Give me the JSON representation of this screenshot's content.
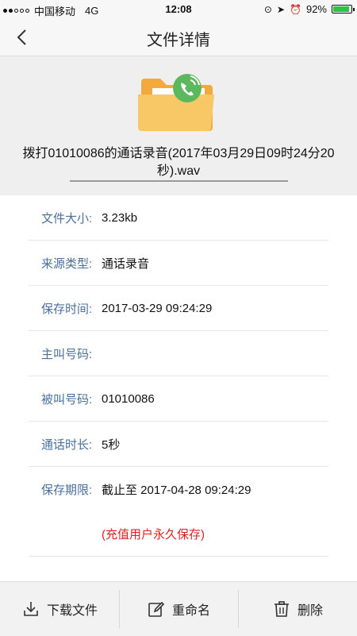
{
  "status_bar": {
    "carrier": "中国移动",
    "network": "4G",
    "time": "12:08",
    "battery_percent": "92%",
    "battery_level": 0.92,
    "icons": [
      "rotation-lock-icon",
      "location-icon",
      "alarm-icon",
      "battery-icon"
    ]
  },
  "nav": {
    "title": "文件详情",
    "back_icon": "chevron-left-icon"
  },
  "file": {
    "icon": "folder-phone-icon",
    "name": "拨打01010086的通话录音(2017年03月29日09时24分20秒).wav"
  },
  "details": [
    {
      "label": "文件大小:",
      "value": "3.23kb"
    },
    {
      "label": "来源类型:",
      "value": "通话录音"
    },
    {
      "label": "保存时间:",
      "value": "2017-03-29 09:24:29"
    },
    {
      "label": "主叫号码:",
      "value": ""
    },
    {
      "label": "被叫号码:",
      "value": "01010086"
    },
    {
      "label": "通话时长:",
      "value": "5秒"
    },
    {
      "label": "保存期限:",
      "value": "截止至 2017-04-28 09:24:29"
    }
  ],
  "note": "(充值用户永久保存)",
  "toolbar": [
    {
      "label": "下载文件",
      "icon": "download-icon"
    },
    {
      "label": "重命名",
      "icon": "edit-icon"
    },
    {
      "label": "删除",
      "icon": "trash-icon"
    }
  ],
  "colors": {
    "label": "#4a6f9c",
    "note": "#e02020",
    "folder": "#f6bc52",
    "badge": "#5cb85c",
    "battery": "#2bc640"
  }
}
